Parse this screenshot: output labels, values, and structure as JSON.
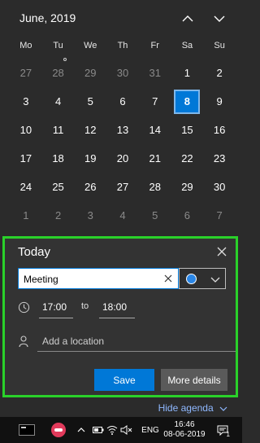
{
  "calendar": {
    "month_label": "June, 2019",
    "weekdays": [
      "Mo",
      "Tu",
      "We",
      "Th",
      "Fr",
      "Sa",
      "Su"
    ],
    "days": [
      {
        "d": "27",
        "out": true
      },
      {
        "d": "28",
        "out": true
      },
      {
        "d": "29",
        "out": true
      },
      {
        "d": "30",
        "out": true
      },
      {
        "d": "31",
        "out": true
      },
      {
        "d": "1",
        "out": false
      },
      {
        "d": "2",
        "out": false
      },
      {
        "d": "3",
        "out": false
      },
      {
        "d": "4",
        "out": false
      },
      {
        "d": "5",
        "out": false
      },
      {
        "d": "6",
        "out": false
      },
      {
        "d": "7",
        "out": false
      },
      {
        "d": "8",
        "out": false,
        "today": true
      },
      {
        "d": "9",
        "out": false
      },
      {
        "d": "10",
        "out": false
      },
      {
        "d": "11",
        "out": false
      },
      {
        "d": "12",
        "out": false
      },
      {
        "d": "13",
        "out": false
      },
      {
        "d": "14",
        "out": false
      },
      {
        "d": "15",
        "out": false
      },
      {
        "d": "16",
        "out": false
      },
      {
        "d": "17",
        "out": false
      },
      {
        "d": "18",
        "out": false
      },
      {
        "d": "19",
        "out": false
      },
      {
        "d": "20",
        "out": false
      },
      {
        "d": "21",
        "out": false
      },
      {
        "d": "22",
        "out": false
      },
      {
        "d": "23",
        "out": false
      },
      {
        "d": "24",
        "out": false
      },
      {
        "d": "25",
        "out": false
      },
      {
        "d": "26",
        "out": false
      },
      {
        "d": "27",
        "out": false
      },
      {
        "d": "28",
        "out": false
      },
      {
        "d": "29",
        "out": false
      },
      {
        "d": "30",
        "out": false
      },
      {
        "d": "1",
        "out": true
      },
      {
        "d": "2",
        "out": true
      },
      {
        "d": "3",
        "out": true
      },
      {
        "d": "4",
        "out": true
      },
      {
        "d": "5",
        "out": true
      },
      {
        "d": "6",
        "out": true
      },
      {
        "d": "7",
        "out": true
      }
    ],
    "nav_up_icon": "chevron-up-icon",
    "nav_down_icon": "chevron-down-icon"
  },
  "agenda": {
    "title": "Today",
    "event_title_value": "Meeting",
    "color_choice": "#2a86e6",
    "start_time": "17:00",
    "to_label": "to",
    "end_time": "18:00",
    "location_placeholder": "Add a location",
    "save_label": "Save",
    "more_details_label": "More details",
    "hide_agenda_label": "Hide agenda"
  },
  "taskbar": {
    "language": "ENG",
    "time": "16:46",
    "date": "08-06-2019",
    "notification_count": "1"
  },
  "colors": {
    "accent": "#0078d7",
    "highlight_border": "#2ad12a",
    "panel_bg": "#2b2b2b"
  }
}
